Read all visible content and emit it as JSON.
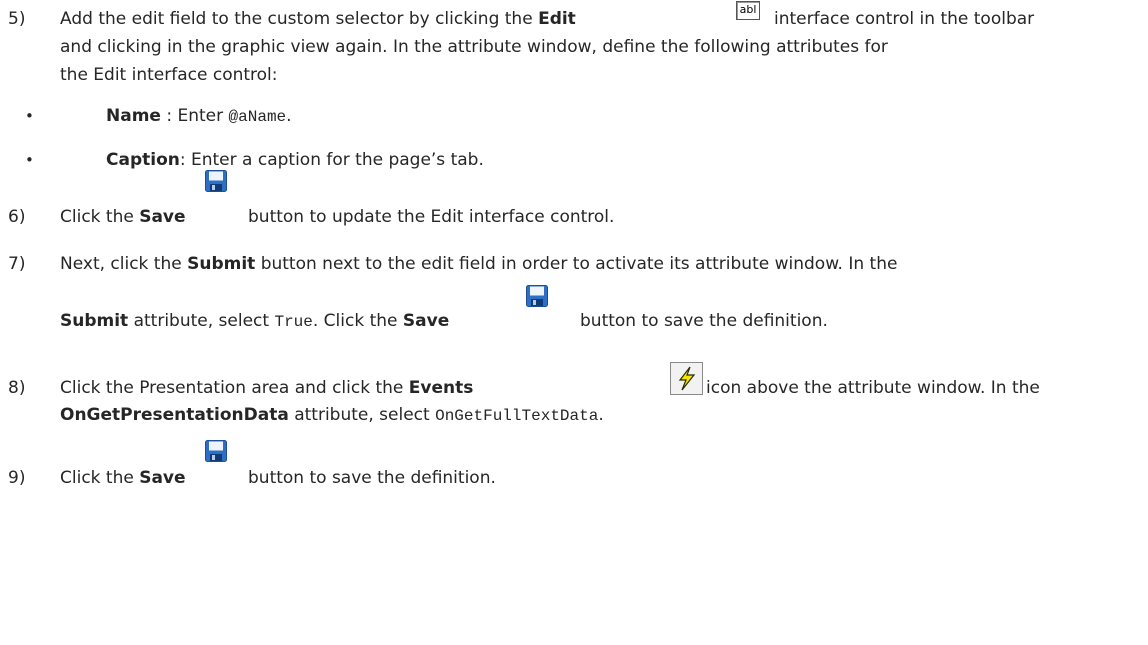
{
  "step5": {
    "num": "5)",
    "l1_a": "Add the edit field to the custom selector by clicking the ",
    "l1_b": "Edit",
    "icon_text": "abl",
    "l1_c": " interface control in the toolbar",
    "l2": "and clicking in the graphic view again. In the attribute window, define the following attributes for",
    "l3": "the Edit interface control:",
    "bullet_char": "•",
    "b1_label": "Name",
    "b1_mid": " : Enter ",
    "b1_code": "@aName",
    "b1_end": ".",
    "b2_label": "Caption",
    "b2_text": ": Enter a caption for the page’s tab."
  },
  "step6": {
    "num": "6)",
    "a": "Click the ",
    "b": "Save",
    "c": "button to update the Edit interface control."
  },
  "step7": {
    "num": "7)",
    "l1_a": "Next, click the ",
    "l1_b": "Submit",
    "l1_c": " button next to the edit field in order to activate its attribute window. In the",
    "l2_a": "Submit",
    "l2_b": " attribute, select ",
    "l2_code": "True",
    "l2_c": ". Click the ",
    "l2_d": "Save",
    "l2_e": "button to save the definition."
  },
  "step8": {
    "num": "8)",
    "l1_a": "Click the Presentation area and click the ",
    "l1_b": "Events",
    "l1_c": "icon above the attribute window. In the",
    "l2_a": "OnGetPresentationData",
    "l2_b": " attribute, select ",
    "l2_code": "OnGetFullTextData",
    "l2_c": "."
  },
  "step9": {
    "num": "9)",
    "a": "Click the ",
    "b": "Save",
    "c": "button to save the definition."
  },
  "icons": {
    "edit": "edit-control-icon",
    "save": "floppy-save-icon",
    "events": "lightning-events-icon"
  }
}
